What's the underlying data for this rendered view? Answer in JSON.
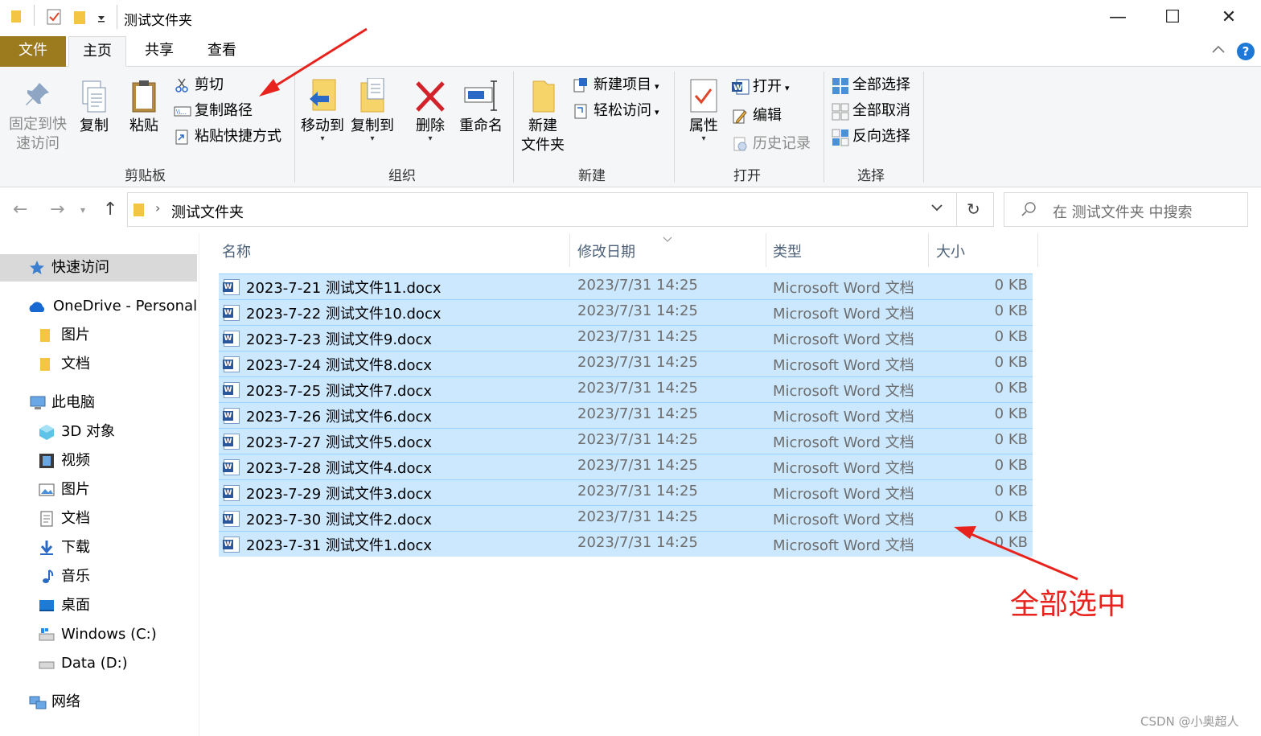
{
  "window": {
    "title": "测试文件夹",
    "controls": {
      "minimize": "—",
      "maximize": "☐",
      "close": "✕"
    }
  },
  "tabs": [
    {
      "label": "文件"
    },
    {
      "label": "主页"
    },
    {
      "label": "共享"
    },
    {
      "label": "查看"
    }
  ],
  "ribbon": {
    "clipboard": {
      "pin_label_1": "固定到快",
      "pin_label_2": "速访问",
      "copy": "复制",
      "paste": "粘贴",
      "cut": "剪切",
      "copy_path": "复制路径",
      "paste_shortcut": "粘贴快捷方式",
      "group": "剪贴板"
    },
    "organize": {
      "move_to": "移动到",
      "copy_to": "复制到",
      "delete": "删除",
      "rename": "重命名",
      "group": "组织"
    },
    "new": {
      "new_folder_1": "新建",
      "new_folder_2": "文件夹",
      "new_item": "新建项目",
      "easy_access": "轻松访问",
      "group": "新建"
    },
    "open": {
      "properties": "属性",
      "open": "打开",
      "edit": "编辑",
      "history": "历史记录",
      "group": "打开"
    },
    "select": {
      "select_all": "全部选择",
      "select_none": "全部取消",
      "invert": "反向选择",
      "group": "选择"
    }
  },
  "address": {
    "path": "测试文件夹",
    "search_placeholder": "在 测试文件夹 中搜索"
  },
  "sidebar": {
    "quick_access": "快速访问",
    "onedrive": "OneDrive - Personal",
    "od_pictures": "图片",
    "od_documents": "文档",
    "this_pc": "此电脑",
    "objects_3d": "3D 对象",
    "videos": "视频",
    "pictures": "图片",
    "documents": "文档",
    "downloads": "下载",
    "music": "音乐",
    "desktop": "桌面",
    "drive_c": "Windows (C:)",
    "drive_d": "Data (D:)",
    "network": "网络"
  },
  "columns": {
    "name": "名称",
    "date": "修改日期",
    "type": "类型",
    "size": "大小"
  },
  "files": [
    {
      "name": "2023-7-21 测试文件11.docx",
      "date": "2023/7/31 14:25",
      "type": "Microsoft Word 文档",
      "size": "0 KB"
    },
    {
      "name": "2023-7-22 测试文件10.docx",
      "date": "2023/7/31 14:25",
      "type": "Microsoft Word 文档",
      "size": "0 KB"
    },
    {
      "name": "2023-7-23 测试文件9.docx",
      "date": "2023/7/31 14:25",
      "type": "Microsoft Word 文档",
      "size": "0 KB"
    },
    {
      "name": "2023-7-24 测试文件8.docx",
      "date": "2023/7/31 14:25",
      "type": "Microsoft Word 文档",
      "size": "0 KB"
    },
    {
      "name": "2023-7-25 测试文件7.docx",
      "date": "2023/7/31 14:25",
      "type": "Microsoft Word 文档",
      "size": "0 KB"
    },
    {
      "name": "2023-7-26 测试文件6.docx",
      "date": "2023/7/31 14:25",
      "type": "Microsoft Word 文档",
      "size": "0 KB"
    },
    {
      "name": "2023-7-27 测试文件5.docx",
      "date": "2023/7/31 14:25",
      "type": "Microsoft Word 文档",
      "size": "0 KB"
    },
    {
      "name": "2023-7-28 测试文件4.docx",
      "date": "2023/7/31 14:25",
      "type": "Microsoft Word 文档",
      "size": "0 KB"
    },
    {
      "name": "2023-7-29 测试文件3.docx",
      "date": "2023/7/31 14:25",
      "type": "Microsoft Word 文档",
      "size": "0 KB"
    },
    {
      "name": "2023-7-30 测试文件2.docx",
      "date": "2023/7/31 14:25",
      "type": "Microsoft Word 文档",
      "size": "0 KB"
    },
    {
      "name": "2023-7-31 测试文件1.docx",
      "date": "2023/7/31 14:25",
      "type": "Microsoft Word 文档",
      "size": "0 KB"
    }
  ],
  "annotation": {
    "text": "全部选中",
    "color": "#e8231d"
  },
  "watermark": "CSDN @小奥超人"
}
